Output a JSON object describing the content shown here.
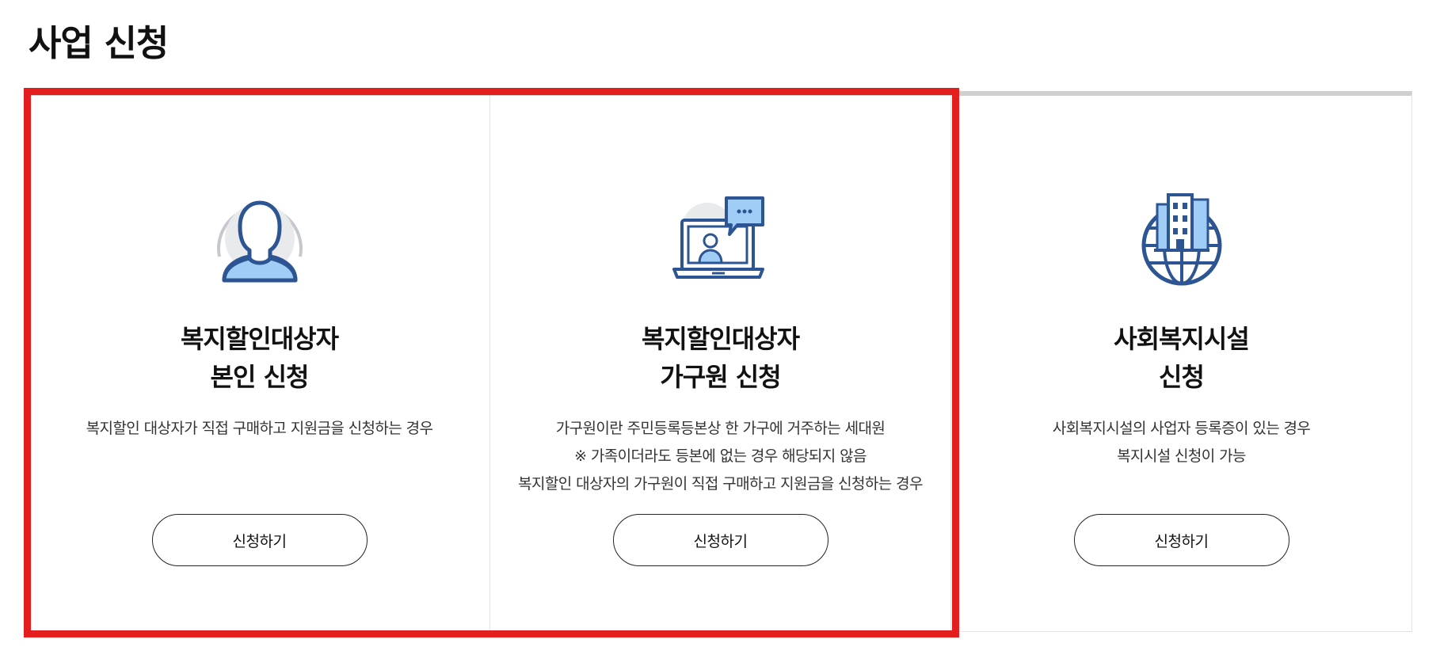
{
  "page": {
    "title": "사업 신청"
  },
  "colors": {
    "accent": "#e41e1e",
    "icon_blue": "#2d5593",
    "icon_light_blue": "#9fcdf5"
  },
  "cards": [
    {
      "icon": "person-icon",
      "title_line1": "복지할인대상자",
      "title_line2": "본인 신청",
      "desc": [
        "복지할인 대상자가 직접 구매하고 지원금을 신청하는 경우"
      ],
      "button_label": "신청하기"
    },
    {
      "icon": "video-call-icon",
      "title_line1": "복지할인대상자",
      "title_line2": "가구원 신청",
      "desc": [
        "가구원이란 주민등록등본상 한 가구에 거주하는 세대원",
        "※ 가족이더라도 등본에 없는 경우 해당되지 않음",
        "복지할인 대상자의 가구원이 직접 구매하고 지원금을 신청하는 경우"
      ],
      "button_label": "신청하기"
    },
    {
      "icon": "building-globe-icon",
      "title_line1": "사회복지시설",
      "title_line2": "신청",
      "desc": [
        "사회복지시설의 사업자 등록증이 있는 경우",
        "복지시설 신청이 가능"
      ],
      "button_label": "신청하기"
    }
  ]
}
